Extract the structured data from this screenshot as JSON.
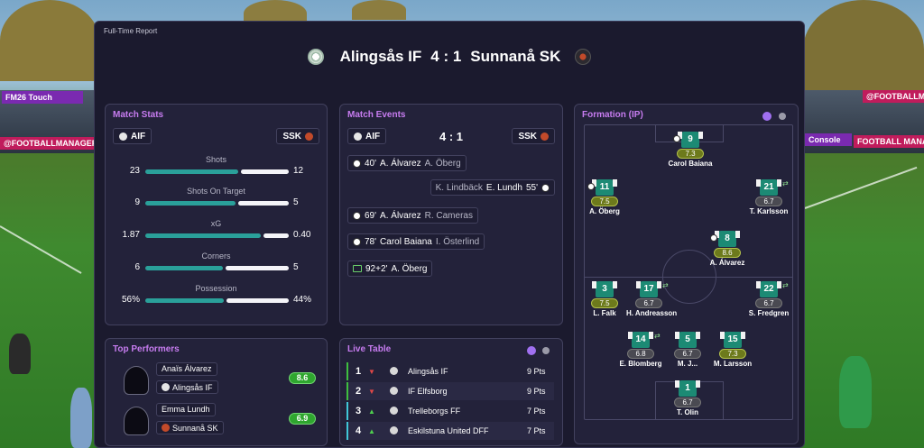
{
  "banners": {
    "left_top": "FM26 Touch",
    "left_bottom": "@FOOTBALLMANAGER",
    "right_top": "@FOOTBALLM",
    "right_bottom": "FOOTBALL MANA",
    "right_mid": "Console"
  },
  "window": {
    "title": "Full-Time Report"
  },
  "header": {
    "home_team": "Alingsås IF",
    "score": "4 : 1",
    "away_team": "Sunnanå SK"
  },
  "match_stats": {
    "title": "Match Stats",
    "home_abbr": "AIF",
    "away_abbr": "SSK",
    "rows": [
      {
        "label": "Shots",
        "home": "23",
        "away": "12",
        "home_frac": 0.66,
        "away_frac": 0.34
      },
      {
        "label": "Shots On Target",
        "home": "9",
        "away": "5",
        "home_frac": 0.64,
        "away_frac": 0.36
      },
      {
        "label": "xG",
        "home": "1.87",
        "away": "0.40",
        "home_frac": 0.82,
        "away_frac": 0.18
      },
      {
        "label": "Corners",
        "home": "6",
        "away": "5",
        "home_frac": 0.55,
        "away_frac": 0.45
      },
      {
        "label": "Possession",
        "home": "56%",
        "away": "44%",
        "home_frac": 0.56,
        "away_frac": 0.44
      }
    ]
  },
  "match_events": {
    "title": "Match Events",
    "home_abbr": "AIF",
    "score": "4 : 1",
    "away_abbr": "SSK",
    "events": [
      {
        "side": "home",
        "type": "goal",
        "minute": "40'",
        "scorer": "A. Álvarez",
        "assist": "A. Öberg"
      },
      {
        "side": "away",
        "type": "goal",
        "minute": "55'",
        "scorer": "E. Lundh",
        "assist": "K. Lindbäck"
      },
      {
        "side": "home",
        "type": "goal",
        "minute": "69'",
        "scorer": "A. Álvarez",
        "assist": "R. Cameras"
      },
      {
        "side": "home",
        "type": "goal",
        "minute": "78'",
        "scorer": "Carol Baiana",
        "assist": "I. Österlind"
      },
      {
        "side": "home",
        "type": "sub",
        "minute": "92+2'",
        "scorer": "A. Öberg",
        "assist": ""
      }
    ]
  },
  "top_performers": {
    "title": "Top Performers",
    "players": [
      {
        "name": "Anaïs Álvarez",
        "club": "Alingsås IF",
        "rating": "8.6"
      },
      {
        "name": "Emma Lundh",
        "club": "Sunnanå SK",
        "rating": "6.9"
      }
    ]
  },
  "live_table": {
    "title": "Live Table",
    "rows": [
      {
        "pos": "1",
        "trend": "down",
        "team": "Alingsås IF",
        "pts": "9 Pts",
        "edge": "#3fbf3f"
      },
      {
        "pos": "2",
        "trend": "down",
        "team": "IF Elfsborg",
        "pts": "9 Pts",
        "edge": "#3fbf3f"
      },
      {
        "pos": "3",
        "trend": "up",
        "team": "Trelleborgs FF",
        "pts": "7 Pts",
        "edge": "#40c8d8"
      },
      {
        "pos": "4",
        "trend": "up",
        "team": "Eskilstuna United DFF",
        "pts": "7 Pts",
        "edge": "#40c8d8"
      }
    ]
  },
  "formation": {
    "title": "Formation (IP)",
    "players": [
      {
        "num": "9",
        "rating": "7.3",
        "name": "Carol Baiana",
        "hi": true,
        "goal": true
      },
      {
        "num": "11",
        "rating": "7.5",
        "name": "A. Öberg",
        "hi": true,
        "goal": true
      },
      {
        "num": "21",
        "rating": "6.7",
        "name": "T. Karlsson",
        "hi": false,
        "sub": true
      },
      {
        "num": "8",
        "rating": "8.6",
        "name": "A. Álvarez",
        "hi": true,
        "goal": true
      },
      {
        "num": "3",
        "rating": "7.5",
        "name": "L. Falk",
        "hi": true
      },
      {
        "num": "17",
        "rating": "6.7",
        "name": "H. Andreasson",
        "hi": false,
        "sub": true
      },
      {
        "num": "22",
        "rating": "6.7",
        "name": "S. Fredgren",
        "hi": false,
        "sub": true
      },
      {
        "num": "14",
        "rating": "6.8",
        "name": "E. Blomberg",
        "hi": false,
        "sub": true
      },
      {
        "num": "5",
        "rating": "6.7",
        "name": "M. J...",
        "hi": false
      },
      {
        "num": "15",
        "rating": "7.3",
        "name": "M. Larsson",
        "hi": true
      },
      {
        "num": "1",
        "rating": "6.7",
        "name": "T. Olin",
        "hi": false
      }
    ]
  },
  "colors": {
    "accent": "#c77cf0",
    "teal": "#2aa09a",
    "panel": "#1b1a2e",
    "rating_green": "#2fa62f"
  }
}
